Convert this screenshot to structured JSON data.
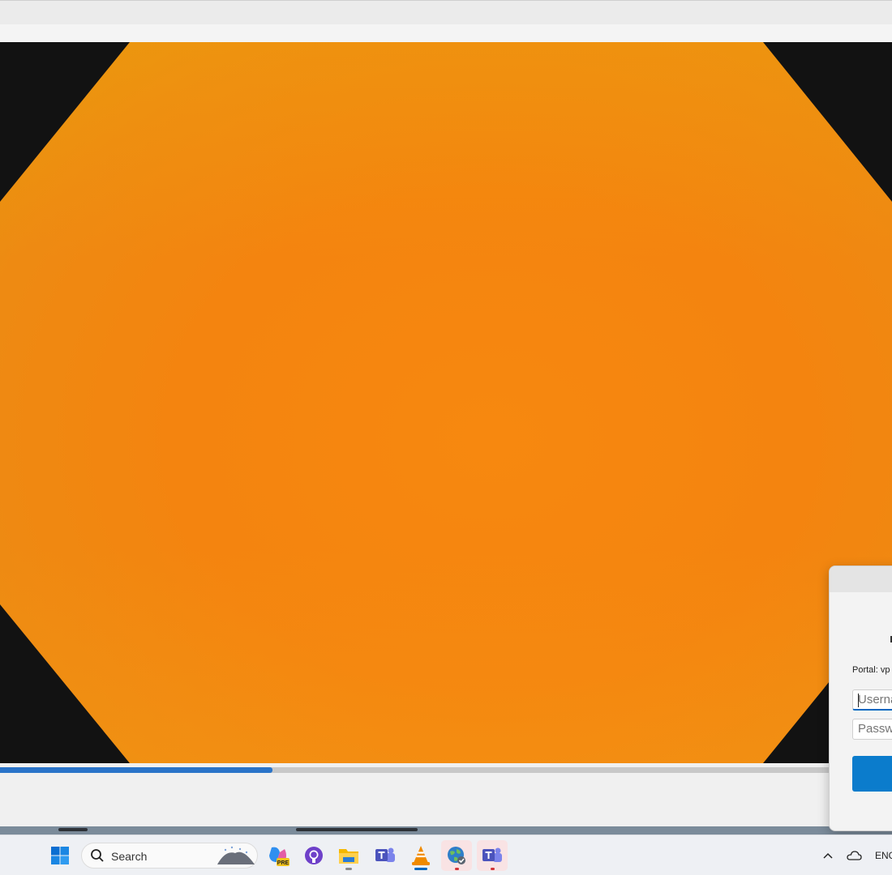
{
  "player": {
    "progress_percent": 30.5,
    "colors": {
      "accent": "#2a74c9",
      "video_fill": "#f4840f",
      "letterbox": "#121212"
    }
  },
  "vpn_dialog": {
    "portal_label": "Portal: vp",
    "username_placeholder": "Userna",
    "password_placeholder": "Passwo",
    "colors": {
      "button": "#0b7ccc"
    }
  },
  "taskbar": {
    "search_label": "Search",
    "language": "ENG",
    "apps": [
      {
        "name": "start-icon"
      },
      {
        "name": "copilot-preview-icon",
        "badge": "PRE"
      },
      {
        "name": "github-icon"
      },
      {
        "name": "file-explorer-icon"
      },
      {
        "name": "teams-icon"
      },
      {
        "name": "vlc-icon"
      },
      {
        "name": "vpn-globe-icon"
      },
      {
        "name": "teams-new-icon"
      }
    ]
  }
}
